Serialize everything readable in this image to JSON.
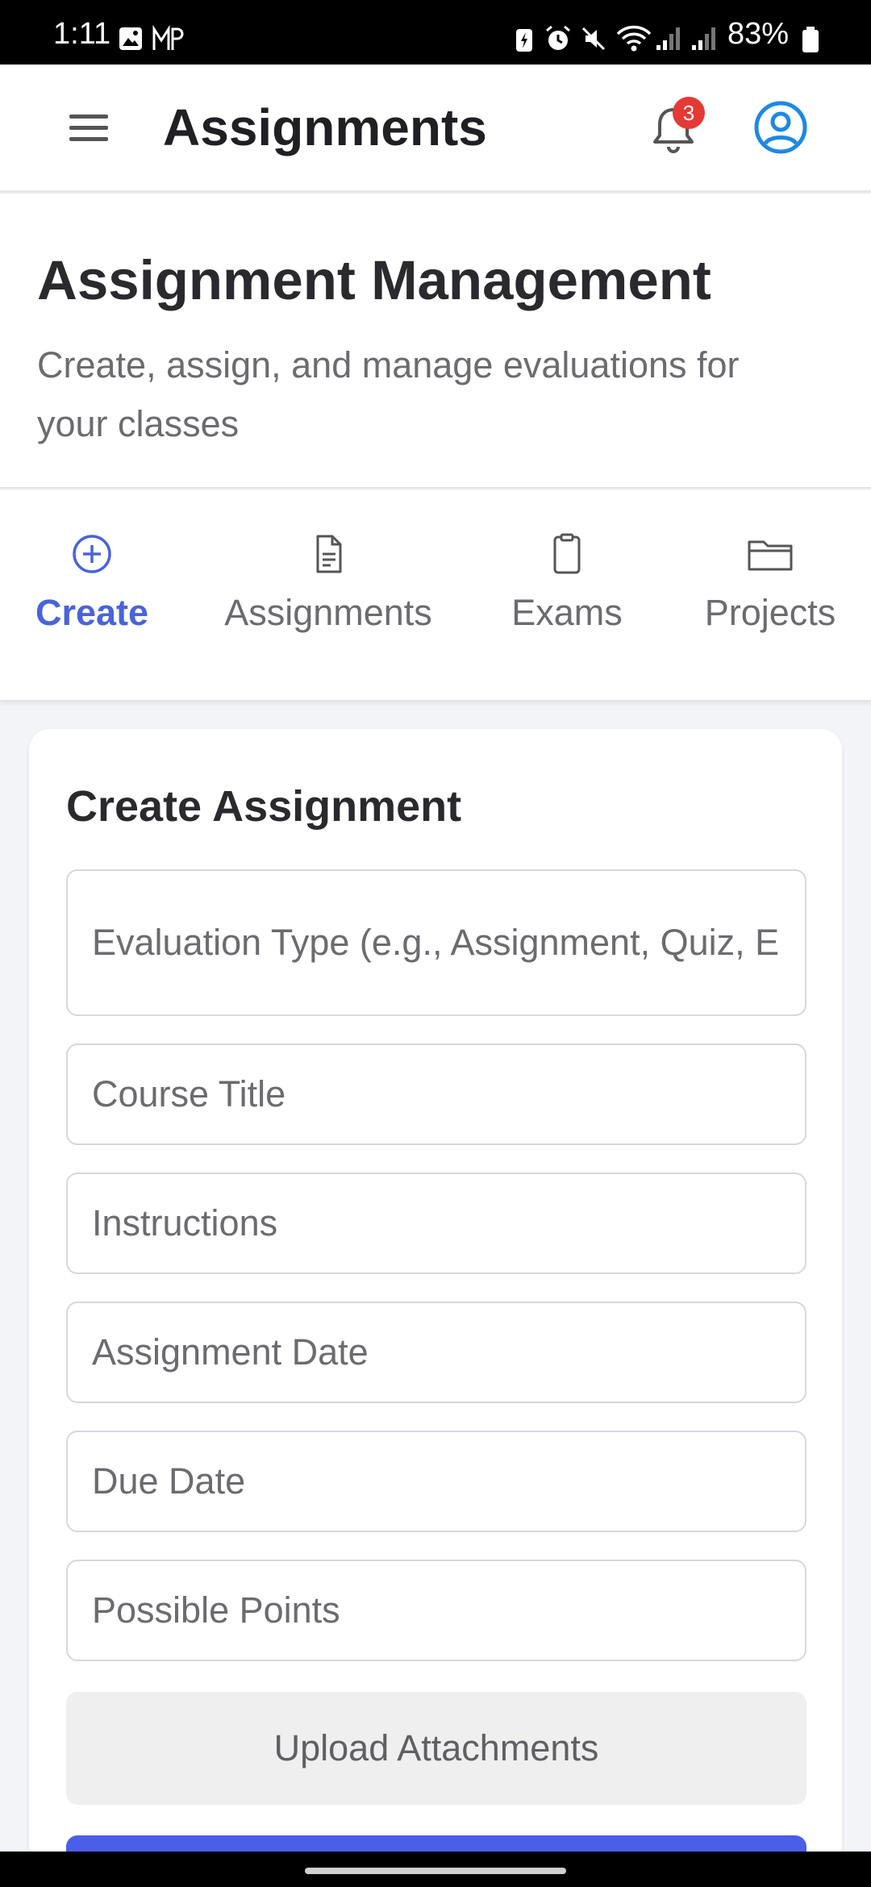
{
  "status_bar": {
    "time": "1:11",
    "battery_text": "83%",
    "left_icons": [
      "gallery-icon",
      "mp-app-icon"
    ],
    "right_icons": [
      "battery-saver-icon",
      "alarm-icon",
      "mute-icon",
      "wifi-icon",
      "signal-icon",
      "signal-icon",
      "battery-icon"
    ]
  },
  "header": {
    "title": "Assignments",
    "notification_count": "3",
    "menu_icon": "hamburger-menu-icon",
    "bell_icon": "bell-icon",
    "account_icon": "account-circle-icon"
  },
  "intro": {
    "title": "Assignment Management",
    "subtitle": "Create, assign, and manage evaluations for your classes"
  },
  "tabs": [
    {
      "label": "Create",
      "icon": "plus-circle-icon",
      "active": true
    },
    {
      "label": "Assignments",
      "icon": "document-icon",
      "active": false
    },
    {
      "label": "Exams",
      "icon": "clipboard-icon",
      "active": false
    },
    {
      "label": "Projects",
      "icon": "folder-icon",
      "active": false
    }
  ],
  "form": {
    "title": "Create Assignment",
    "fields": {
      "evaluation_type": {
        "placeholder": "Evaluation Type (e.g., Assignment, Quiz, E",
        "value": ""
      },
      "course_title": {
        "placeholder": "Course Title",
        "value": ""
      },
      "instructions": {
        "placeholder": "Instructions",
        "value": ""
      },
      "assignment_date": {
        "placeholder": "Assignment Date",
        "value": ""
      },
      "due_date": {
        "placeholder": "Due Date",
        "value": ""
      },
      "possible_points": {
        "placeholder": "Possible Points",
        "value": ""
      }
    },
    "upload_label": "Upload Attachments"
  },
  "colors": {
    "accent": "#4a63d9",
    "submit_button": "#4a5ee8",
    "badge": "#e53935",
    "account_icon": "#1e88e5",
    "page_background": "#f3f4f8"
  }
}
